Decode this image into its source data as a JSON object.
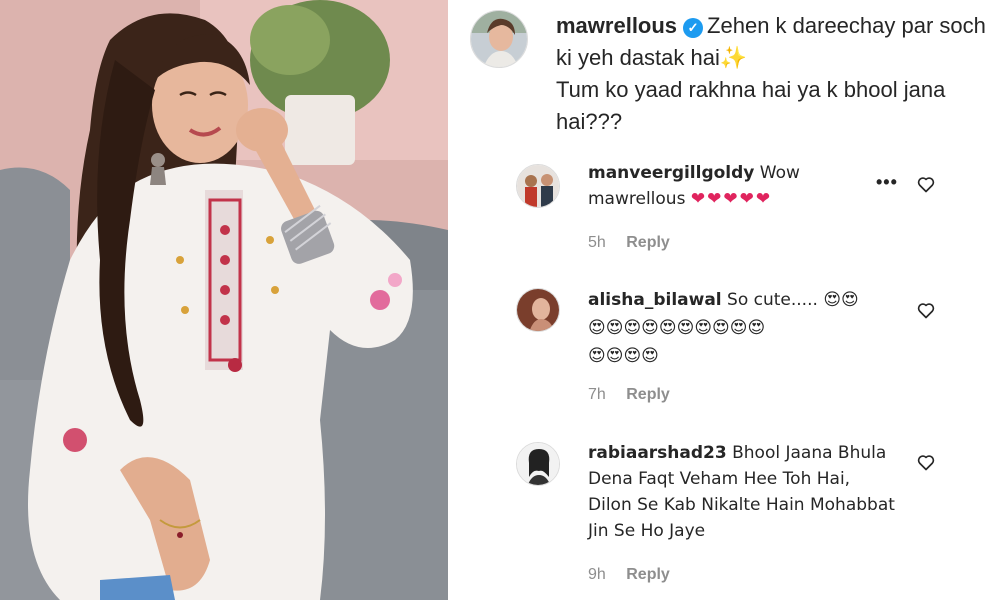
{
  "post": {
    "author": {
      "username": "mawrellous",
      "verified": true,
      "caption_line1": "Zehen k dareechay par soch ki yeh dastak hai",
      "caption_emoji": "✨",
      "caption_line2": "Tum ko yaad rakhna hai ya k bhool jana hai???"
    }
  },
  "comments": [
    {
      "username": "manveergillgoldy",
      "text": "Wow mawrellous",
      "emojis": "❤❤❤❤❤",
      "time": "5h",
      "reply_label": "Reply",
      "more_icon": "more-horizontal-icon",
      "like_icon": "heart-outline-icon"
    },
    {
      "username": "alisha_bilawal",
      "text": "So cute.....",
      "emojis_line1": "😍😍",
      "emojis_line2": "😍😍😍😍😍😍😍😍😍😍",
      "emojis_line3": "😍😍😍😍",
      "time": "7h",
      "reply_label": "Reply",
      "like_icon": "heart-outline-icon"
    },
    {
      "username": "rabiaarshad23",
      "text": "Bhool Jaana Bhula Dena Faqt Veham Hee Toh Hai, Dilon Se Kab Nikalte Hain Mohabbat Jin Se Ho Jaye",
      "time": "9h",
      "reply_label": "Reply",
      "like_icon": "heart-outline-icon"
    }
  ],
  "colors": {
    "verified_badge": "#1d9bf0",
    "meta_text": "#8e8e8e",
    "heart_emoji": "#e0245e"
  }
}
